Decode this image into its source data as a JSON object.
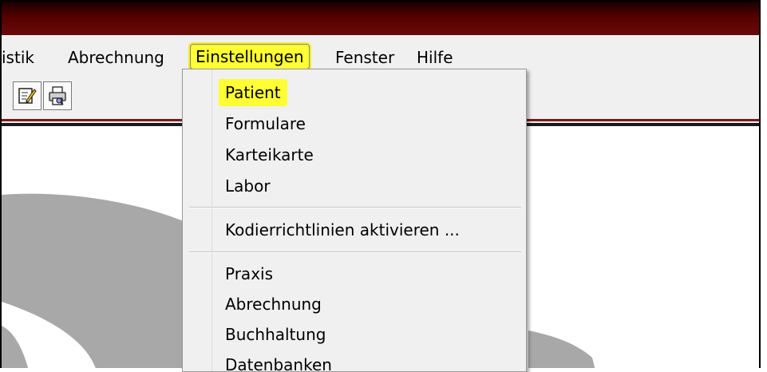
{
  "menubar": {
    "items": [
      {
        "label": "istik"
      },
      {
        "label": "Abrechnung"
      },
      {
        "label": "Einstellungen"
      },
      {
        "label": "Fenster"
      },
      {
        "label": "Hilfe"
      }
    ]
  },
  "toolbar": {
    "buttons": [
      {
        "icon": "edit-document-icon"
      },
      {
        "icon": "print-preview-icon"
      }
    ]
  },
  "dropdown": {
    "groups": [
      [
        "Patient",
        "Formulare",
        "Karteikarte",
        "Labor"
      ],
      [
        "Kodierrichtlinien aktivieren ..."
      ],
      [
        "Praxis",
        "Abrechnung",
        "Buchhaltung",
        "Datenbanken"
      ]
    ],
    "highlighted": "Patient"
  },
  "colors": {
    "titlebar": "#550000",
    "highlight": "#ffff33",
    "menu_bg": "#f0f0f0",
    "rule_red": "#7a1a1a",
    "workspace_shape": "#a8a8a8"
  }
}
